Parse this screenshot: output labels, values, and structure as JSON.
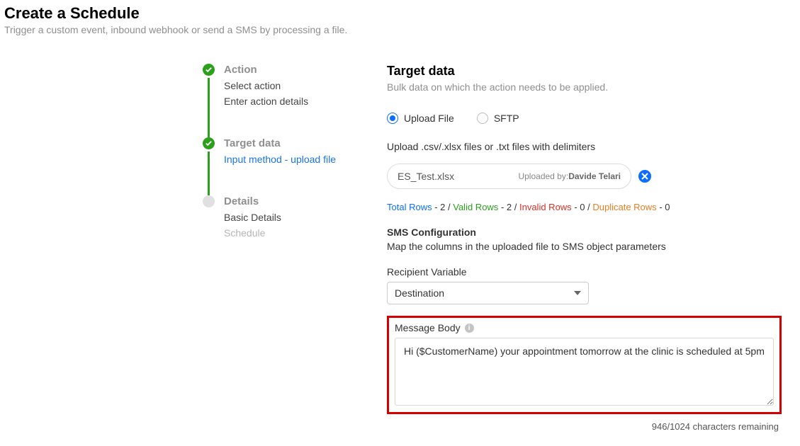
{
  "page": {
    "title": "Create a Schedule",
    "subtitle": "Trigger a custom event, inbound webhook or send a SMS by processing a file."
  },
  "stepper": {
    "steps": [
      {
        "title": "Action",
        "subs": [
          "Select action",
          "Enter action details"
        ],
        "state": "done"
      },
      {
        "title": "Target data",
        "subs_link": [
          "Input method - upload file"
        ],
        "state": "done"
      },
      {
        "title": "Details",
        "subs": [
          "Basic Details"
        ],
        "subs_muted": [
          "Schedule"
        ],
        "state": "pending"
      }
    ]
  },
  "target": {
    "heading": "Target data",
    "subheading": "Bulk data on which the action needs to be applied.",
    "radios": {
      "upload": "Upload File",
      "sftp": "SFTP",
      "selected": "upload"
    },
    "upload_hint": "Upload .csv/.xlsx files or .txt files with delimiters",
    "file": {
      "name": "ES_Test.xlsx",
      "uploaded_by_label": "Uploaded by:",
      "uploaded_by": "Davide Telari"
    },
    "stats": {
      "total_label": "Total Rows",
      "total": "2",
      "valid_label": "Valid Rows",
      "valid": "2",
      "invalid_label": "Invalid Rows",
      "invalid": "0",
      "dup_label": "Duplicate Rows",
      "dup": "0"
    },
    "sms": {
      "heading": "SMS Configuration",
      "sub": "Map the columns in the uploaded file to SMS object parameters",
      "recipient_label": "Recipient Variable",
      "recipient_value": "Destination",
      "body_label": "Message Body",
      "body_value": "Hi ($CustomerName) your appointment tomorrow at the clinic is scheduled at 5pm",
      "counter": "946/1024 characters remaining"
    }
  }
}
